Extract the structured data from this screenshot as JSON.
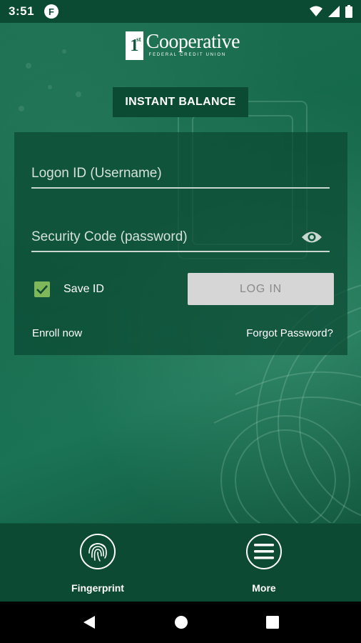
{
  "status_bar": {
    "time": "3:51",
    "app_icon_letter": "F",
    "icons": [
      "wifi-icon",
      "cellular-icon",
      "battery-icon"
    ]
  },
  "logo": {
    "mark": "1",
    "mark_sup": "st",
    "name": "Cooperative",
    "subtitle": "FEDERAL CREDIT UNION"
  },
  "instant_balance": {
    "label": "INSTANT BALANCE"
  },
  "login": {
    "username_placeholder": "Logon ID (Username)",
    "password_placeholder": "Security Code (password)",
    "save_id_label": "Save ID",
    "save_id_checked": true,
    "login_label": "LOG IN",
    "enroll_label": "Enroll now",
    "forgot_label": "Forgot Password?"
  },
  "bottom_nav": {
    "fingerprint_label": "Fingerprint",
    "more_label": "More"
  },
  "colors": {
    "brand_green": "#0f5a3e",
    "dark_green": "#0b4a33",
    "checkbox_green": "#7fb85a",
    "button_disabled": "#d6d6d6"
  }
}
